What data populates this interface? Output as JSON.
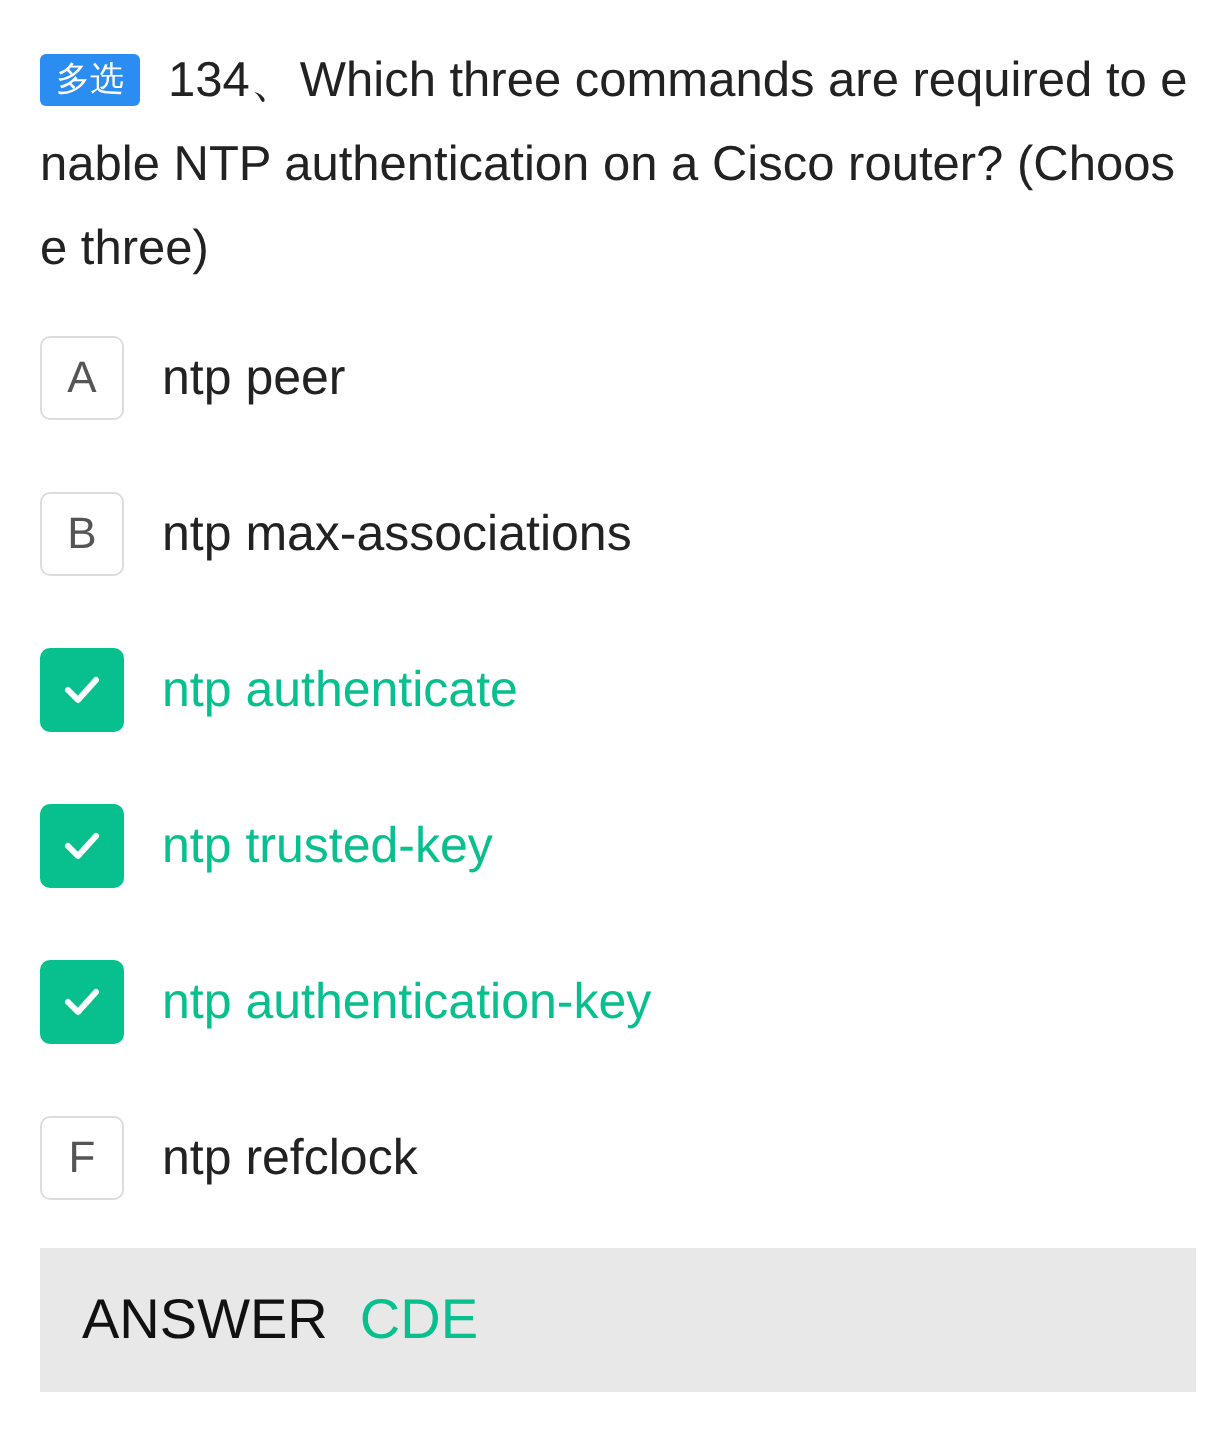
{
  "question": {
    "badge": "多选",
    "text": "134、Which three commands are required to enable NTP authentication on a Cisco router? (Choose three)"
  },
  "options": [
    {
      "letter": "A",
      "text": "ntp peer",
      "selected": false
    },
    {
      "letter": "B",
      "text": "ntp max-associations",
      "selected": false
    },
    {
      "text": "ntp authenticate",
      "selected": true
    },
    {
      "text": "ntp trusted-key",
      "selected": true
    },
    {
      "text": "ntp authentication-key",
      "selected": true
    },
    {
      "letter": "F",
      "text": "ntp refclock",
      "selected": false
    }
  ],
  "answer": {
    "label": "ANSWER",
    "value": "CDE"
  }
}
